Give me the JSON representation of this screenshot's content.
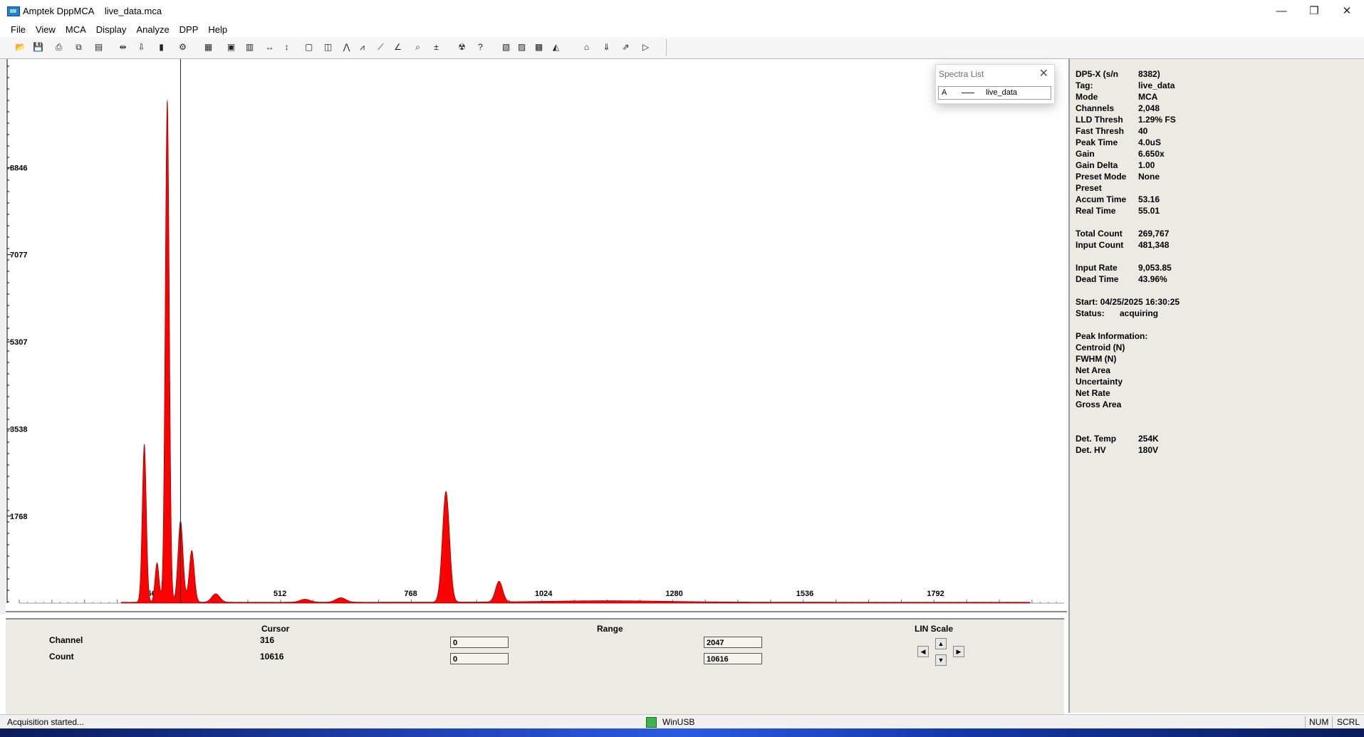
{
  "window": {
    "app_name": "Amptek DppMCA",
    "file_name": "live_data.mca",
    "minimize": "—",
    "restore": "❐",
    "close": "✕"
  },
  "menu": [
    "File",
    "View",
    "MCA",
    "Display",
    "Analyze",
    "DPP",
    "Help"
  ],
  "toolbar": {
    "icons": [
      "open-icon",
      "save-icon",
      "print-icon",
      "copy-icon",
      "export-icon",
      "connect-icon",
      "sort-icon",
      "device-icon",
      "settings-icon",
      "calibrate-icon",
      "palette-icon",
      "page-icon",
      "horizontal-zoom-icon",
      "vertical-zoom-icon",
      "zoom-box-icon",
      "zoom-fit-icon",
      "peak-icon",
      "peak-search-icon",
      "linear-icon",
      "log-icon",
      "magnify-icon",
      "add-spectra-icon",
      "radiation-icon",
      "help-icon",
      "time-display-icon",
      "fast-display-icon",
      "data-display-icon",
      "energy-display-icon",
      "home-icon",
      "down-icon",
      "forward-icon",
      "next-icon"
    ]
  },
  "spectra_list": {
    "title": "Spectra List",
    "letter": "A",
    "name": "live_data"
  },
  "chart_data": {
    "type": "area",
    "y_ticks": [
      1768,
      3538,
      5307,
      7077,
      8846
    ],
    "x_ticks": [
      256,
      512,
      768,
      1024,
      1280,
      1536,
      1792
    ],
    "x_range": [
      0,
      2047
    ],
    "y_range": [
      0,
      10616
    ],
    "color": "#ff0000",
    "peaks": [
      {
        "channel": 245,
        "height": 3210,
        "width": 4
      },
      {
        "channel": 270,
        "height": 800,
        "width": 4
      },
      {
        "channel": 290,
        "height": 10200,
        "width": 4
      },
      {
        "channel": 316,
        "height": 1650,
        "width": 5
      },
      {
        "channel": 338,
        "height": 1050,
        "width": 5
      },
      {
        "channel": 385,
        "height": 170,
        "width": 8
      },
      {
        "channel": 560,
        "height": 60,
        "width": 10
      },
      {
        "channel": 630,
        "height": 90,
        "width": 10
      },
      {
        "channel": 836,
        "height": 2250,
        "width": 7
      },
      {
        "channel": 940,
        "height": 420,
        "width": 7
      },
      {
        "channel": 1150,
        "height": 30,
        "width": 120
      }
    ]
  },
  "controls": {
    "cursor_label": "Cursor",
    "range_label": "Range",
    "scale_label": "LIN Scale",
    "channel_label": "Channel",
    "count_label": "Count",
    "cursor_channel": "316",
    "cursor_count": "10616",
    "range_channel_min": "0",
    "range_channel_max": "2047",
    "range_count_min": "0",
    "range_count_max": "10616"
  },
  "info": [
    {
      "label": "DP5-X (s/n",
      "value": "8382)"
    },
    {
      "label": "Tag:",
      "value": "live_data"
    },
    {
      "label": "Mode",
      "value": "MCA"
    },
    {
      "label": "Channels",
      "value": "2,048"
    },
    {
      "label": "LLD Thresh",
      "value": "1.29% FS"
    },
    {
      "label": "Fast Thresh",
      "value": "40"
    },
    {
      "label": "Peak Time",
      "value": "4.0uS"
    },
    {
      "label": "Gain",
      "value": "6.650x"
    },
    {
      "label": "Gain Delta",
      "value": "1.00"
    },
    {
      "label": "Preset Mode",
      "value": "None"
    },
    {
      "label": "Preset",
      "value": ""
    },
    {
      "label": "Accum Time",
      "value": "53.16"
    },
    {
      "label": "Real Time",
      "value": "55.01"
    }
  ],
  "counts": [
    {
      "label": "Total Count",
      "value": "269,767"
    },
    {
      "label": "Input Count",
      "value": "481,348"
    }
  ],
  "rates": [
    {
      "label": "Input Rate",
      "value": "9,053.85"
    },
    {
      "label": "Dead Time",
      "value": "43.96%"
    }
  ],
  "run": {
    "start": "Start:  04/25/2025 16:30:25",
    "status_label": "Status:",
    "status_value": "acquiring"
  },
  "peak_info": [
    "Peak Information:",
    "Centroid (N)",
    "FWHM (N)",
    "Net Area",
    "Uncertainty",
    "Net Rate",
    "Gross Area"
  ],
  "detector": [
    {
      "label": "Det. Temp",
      "value": "254K"
    },
    {
      "label": "Det. HV",
      "value": "180V"
    }
  ],
  "status": {
    "message": "Acquisition started...",
    "connection": "WinUSB",
    "num": "NUM",
    "scrl": "SCRL"
  }
}
